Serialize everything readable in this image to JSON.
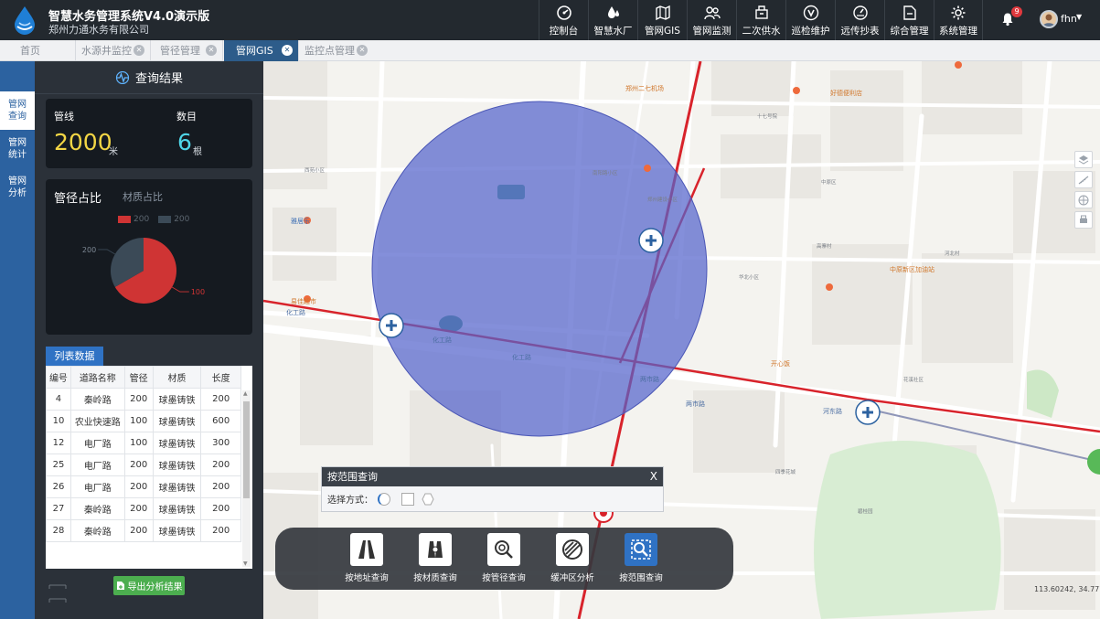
{
  "app": {
    "title": "智慧水务管理系统V4.0演示版",
    "company": "郑州力通水务有限公司"
  },
  "nav": [
    {
      "label": "控制台",
      "icon": "dashboard-icon"
    },
    {
      "label": "智慧水厂",
      "icon": "water-drop-icon"
    },
    {
      "label": "管网GIS",
      "icon": "map-icon"
    },
    {
      "label": "管网监测",
      "icon": "users-monitor-icon"
    },
    {
      "label": "二次供水",
      "icon": "pump-icon"
    },
    {
      "label": "巡检维护",
      "icon": "inspection-icon"
    },
    {
      "label": "远传抄表",
      "icon": "meter-icon"
    },
    {
      "label": "综合管理",
      "icon": "folder-icon"
    },
    {
      "label": "系统管理",
      "icon": "gear-icon"
    }
  ],
  "header": {
    "notification_count": "9",
    "username": "fhn"
  },
  "tabs": [
    {
      "label": "首页",
      "closable": false,
      "active": false
    },
    {
      "label": "水源井监控",
      "closable": true,
      "active": false
    },
    {
      "label": "管径管理",
      "closable": true,
      "active": false
    },
    {
      "label": "管网GIS",
      "closable": true,
      "active": true
    },
    {
      "label": "监控点管理",
      "closable": true,
      "active": false
    }
  ],
  "side_nav": [
    {
      "label": "管网查询",
      "active": true
    },
    {
      "label": "管网统计",
      "active": false
    },
    {
      "label": "管网分析",
      "active": false
    }
  ],
  "panel": {
    "title": "查询结果",
    "pipeline_label": "管线",
    "pipeline_value": "2000",
    "pipeline_unit": "米",
    "count_label": "数目",
    "count_value": "6",
    "count_unit": "根",
    "chart_tab_diameter": "管径占比",
    "chart_tab_material": "材质占比",
    "list_tab": "列表数据",
    "export_button": "导出分析结果"
  },
  "colors": {
    "accent_blue": "#2f72c4",
    "yellow_value": "#f3d645",
    "cyan_value": "#4fd6e8",
    "pie_red": "#cf3434",
    "pie_slate": "#3b4a57",
    "pipe_red": "#d8232b"
  },
  "chart_data": {
    "type": "pie",
    "title": "管径占比",
    "slices": [
      {
        "label": "200",
        "value": 66.7,
        "color": "#cf3434",
        "value_label": "100"
      },
      {
        "label": "200",
        "value": 33.3,
        "color": "#3b4a57",
        "value_label": "200"
      }
    ],
    "legend": [
      "200",
      "200"
    ],
    "legend_position": "top"
  },
  "table": {
    "columns": [
      "编号",
      "道路名称",
      "管径",
      "材质",
      "长度"
    ],
    "rows": [
      [
        "4",
        "秦岭路",
        "200",
        "球墨铸铁",
        "200"
      ],
      [
        "10",
        "农业快速路",
        "100",
        "球墨铸铁",
        "600"
      ],
      [
        "12",
        "电厂路",
        "100",
        "球墨铸铁",
        "300"
      ],
      [
        "25",
        "电厂路",
        "200",
        "球墨铸铁",
        "200"
      ],
      [
        "26",
        "电厂路",
        "200",
        "球墨铸铁",
        "200"
      ],
      [
        "27",
        "秦岭路",
        "200",
        "球墨铸铁",
        "200"
      ],
      [
        "28",
        "秦岭路",
        "200",
        "球墨铸铁",
        "200"
      ]
    ]
  },
  "map": {
    "coordinates": "113.60242, 34.77759",
    "road_labels": [
      "化工路",
      "化工路",
      "化工路",
      "两市路",
      "两市路",
      "河东路"
    ],
    "pois": [
      "郑州二七机场",
      "好德便利店",
      "中原新区加油站",
      "开心饭",
      "易佳超市",
      "雅居乐"
    ],
    "area_labels": [
      "西苑小区",
      "南阳路小区",
      "郑州建设小区",
      "高寨村",
      "河北村",
      "花溪社区",
      "十七号院",
      "中原区",
      "华北小区",
      "四季花城",
      "碧桂园"
    ]
  },
  "range_dialog": {
    "title": "按范围查询",
    "close": "X",
    "method_label": "选择方式："
  },
  "toolbar": [
    {
      "label": "按地址查询",
      "icon": "road-address-icon",
      "active": false
    },
    {
      "label": "按材质查询",
      "icon": "material-icon",
      "active": false
    },
    {
      "label": "按管径查询",
      "icon": "diameter-search-icon",
      "active": false
    },
    {
      "label": "缓冲区分析",
      "icon": "buffer-analysis-icon",
      "active": false
    },
    {
      "label": "按范围查询",
      "icon": "range-query-icon",
      "active": true
    }
  ]
}
